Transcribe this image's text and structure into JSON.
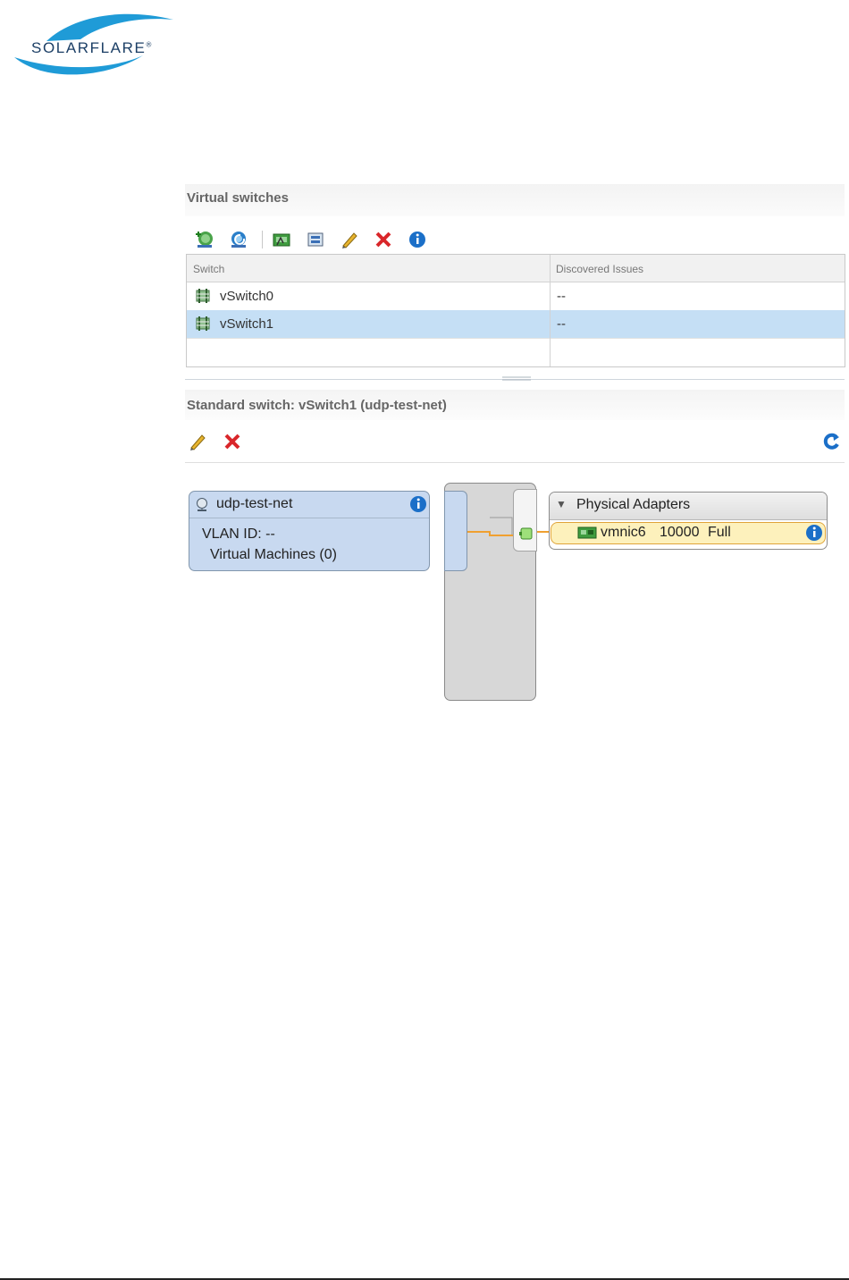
{
  "logo": {
    "text": "SOLARFLARE",
    "reg": "®"
  },
  "virtual_switches": {
    "title": "Virtual switches",
    "toolbar": [
      "add-networking-icon",
      "refresh-icon",
      "manage-physical-adapters-icon",
      "migrate-adapter-icon",
      "edit-icon",
      "delete-icon",
      "info-icon"
    ],
    "columns": [
      "Switch",
      "Discovered Issues"
    ],
    "rows": [
      {
        "name": "vSwitch0",
        "issues": "--",
        "selected": false
      },
      {
        "name": "vSwitch1",
        "issues": "--",
        "selected": true
      }
    ]
  },
  "standard_switch": {
    "title": "Standard switch: vSwitch1 (udp-test-net)",
    "toolbar": [
      "edit-icon",
      "delete-icon",
      "refresh-icon"
    ],
    "port_group": {
      "name": "udp-test-net",
      "vlan": "VLAN ID: --",
      "vms": "Virtual Machines (0)"
    },
    "physical_adapters": {
      "title": "Physical Adapters",
      "adapter": {
        "name": "vmnic6",
        "speed": "10000",
        "duplex": "Full"
      }
    }
  },
  "colors": {
    "selected_row": "#c5dff5",
    "port_group_fill": "#c8d9f0",
    "link_orange": "#f0a030",
    "adapter_highlight": "#fdf1bc",
    "delete_red": "#d9262a",
    "info_blue": "#1b6fc8"
  }
}
